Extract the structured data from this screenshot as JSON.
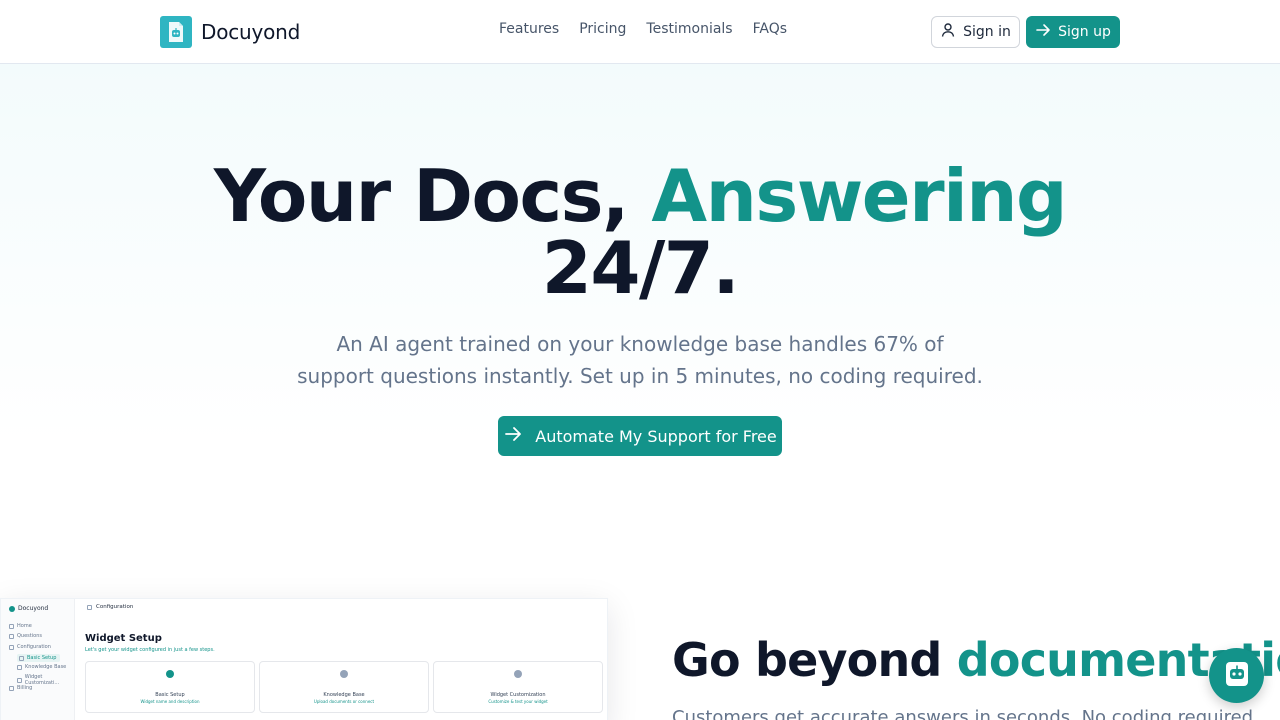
{
  "brand": {
    "name": "Docuyond",
    "logo_icon": "doc-bot-logo-icon"
  },
  "nav": {
    "links": [
      "Features",
      "Pricing",
      "Testimonials",
      "FAQs"
    ],
    "signin_label": "Sign in",
    "signup_label": "Sign up"
  },
  "hero": {
    "title_part1": "Your Docs, ",
    "title_accent": "Answering",
    "title_part2": "24/7.",
    "subtitle_line1": "An AI agent trained on your knowledge base handles 67% of",
    "subtitle_line2": "support questions instantly. Set up in 5 minutes, no coding required.",
    "cta_label": "Automate My Support for Free"
  },
  "preview": {
    "brand": "Docuyond",
    "header": "Configuration",
    "sidebar": [
      "Home",
      "Questions",
      "Configuration",
      "Basic Setup",
      "Knowledge Base",
      "Widget Customizati...",
      "Billing"
    ],
    "title": "Widget Setup",
    "description": "Let's get your widget configured in just a few steps.",
    "cards": [
      {
        "title": "Basic Setup",
        "sub": "Widget name and description"
      },
      {
        "title": "Knowledge Base",
        "sub": "Upload documents or connect"
      },
      {
        "title": "Widget Customization",
        "sub": "Customize & test your widget"
      }
    ]
  },
  "section": {
    "title_part1": "Go beyond ",
    "title_accent": "documentation",
    "subtitle": "Customers get accurate answers in seconds. No coding required."
  },
  "colors": {
    "accent": "#13938a",
    "logo": "#2fb5c2",
    "heading": "#0f172a",
    "muted": "#64748b"
  }
}
